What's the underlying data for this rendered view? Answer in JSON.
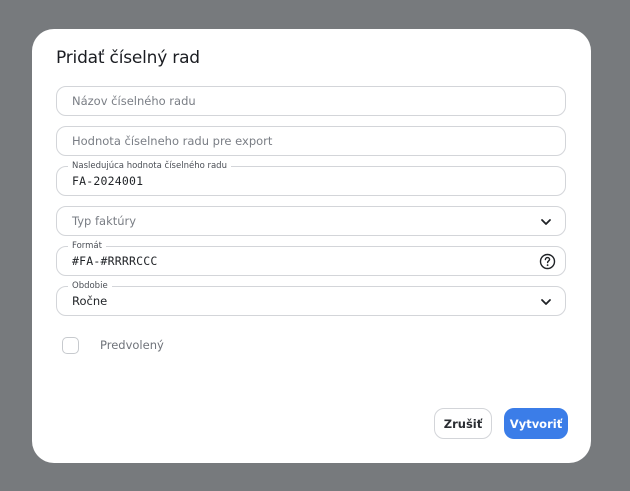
{
  "dialog": {
    "title": "Pridať číselný rad",
    "fields": {
      "name": {
        "placeholder": "Názov číselného radu",
        "value": ""
      },
      "export_value": {
        "placeholder": "Hodnota číselneho radu pre export",
        "value": ""
      },
      "next_value": {
        "label": "Nasledujúca hodnota číselného radu",
        "value": "FA-2024001"
      },
      "invoice_type": {
        "placeholder": "Typ faktúry",
        "value": ""
      },
      "format": {
        "label": "Formát",
        "value": "#FA-#RRRRCCC"
      },
      "period": {
        "label": "Obdobie",
        "value": "Ročne"
      }
    },
    "default_checkbox": {
      "label": "Predvolený",
      "checked": false
    },
    "buttons": {
      "cancel": "Zrušiť",
      "create": "Vytvoriť"
    }
  },
  "icons": {
    "invoice_type_dropdown": "chevron-down-icon",
    "format_help": "help-circle-icon",
    "period_dropdown": "chevron-down-icon"
  },
  "colors": {
    "backdrop": "#777a7d",
    "primary": "#3b7de8",
    "border": "#d3d5d9"
  }
}
